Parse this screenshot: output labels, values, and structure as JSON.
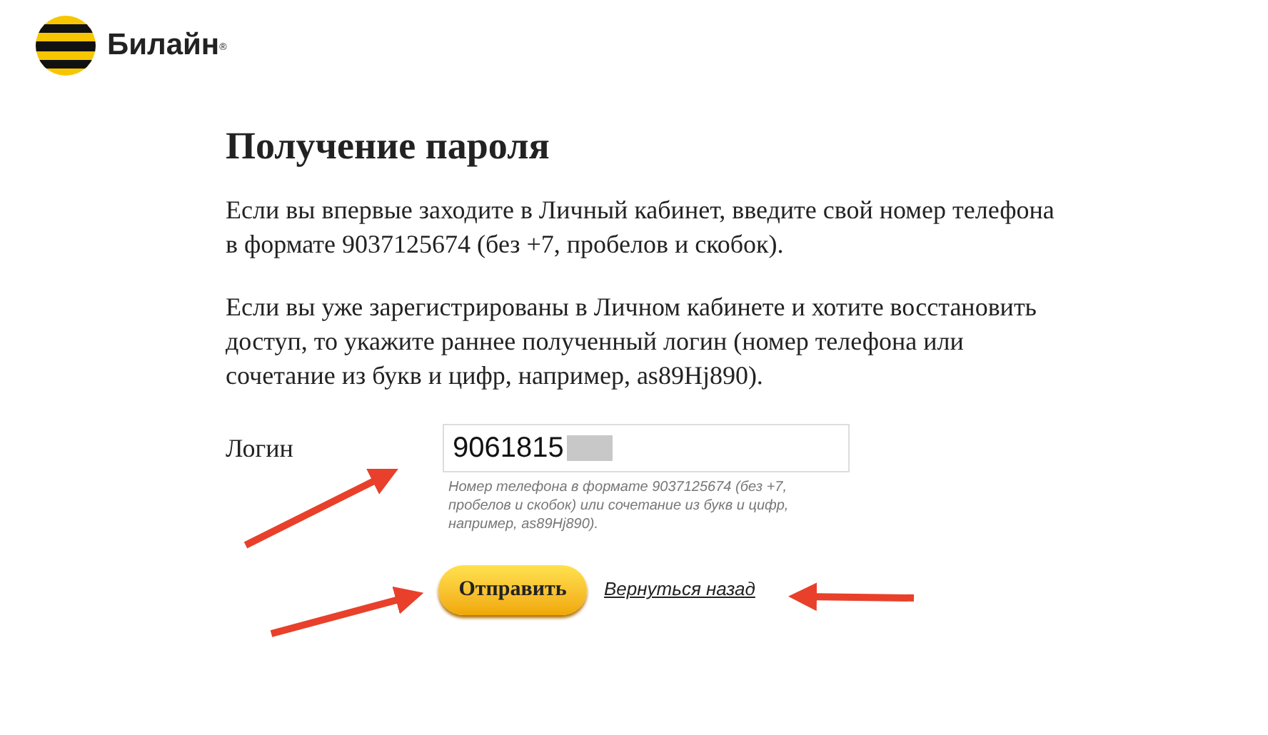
{
  "logo": {
    "text": "Билайн",
    "mark": "®"
  },
  "title": "Получение пароля",
  "paragraphs": [
    "Если вы впервые заходите в Личный кабинет, введите свой номер телефона в формате 9037125674 (без +7, пробелов и скобок).",
    "Если вы уже зарегистрированы в Личном кабинете и хотите восстановить доступ, то укажите раннее полученный логин (номер телефона или сочетание из букв и цифр, например, as89Hj890)."
  ],
  "login": {
    "label": "Логин",
    "value": "9061815",
    "hint": "Номер телефона в формате 9037125674 (без +7, пробелов и скобок) или сочетание из букв и цифр, например, as89Hj890)."
  },
  "submit": "Отправить",
  "back_link": "Вернуться назад"
}
